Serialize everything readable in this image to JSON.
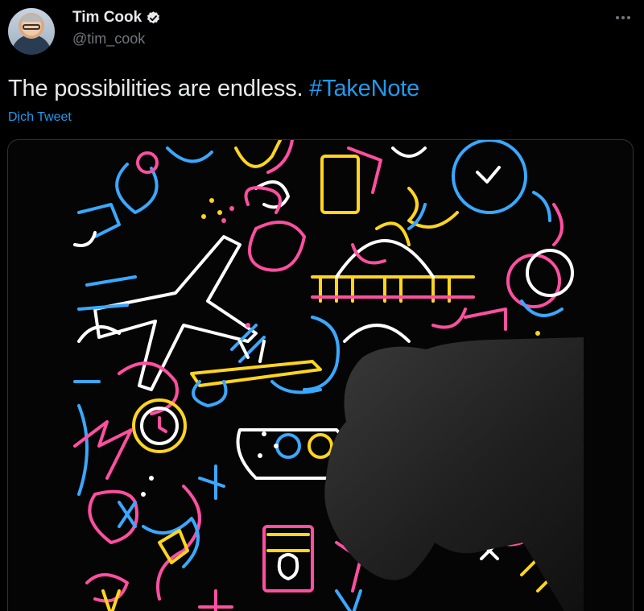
{
  "author": {
    "display_name": "Tim Cook",
    "handle": "@tim_cook",
    "verified_icon": "verified-badge-icon"
  },
  "tweet": {
    "text_plain": "The possibilities are endless.",
    "hashtag": "#TakeNote",
    "translate_label": "Dịch Tweet"
  },
  "more_icon": "more-options-icon",
  "colors": {
    "background": "#000000",
    "text": "#e7e9ea",
    "muted": "#71767b",
    "link": "#1d9bf0",
    "verified": "#ffffff",
    "doodle_blue": "#3aa8ff",
    "doodle_pink": "#ff4fa0",
    "doodle_yellow": "#ffd51e",
    "doodle_white": "#ffffff"
  }
}
